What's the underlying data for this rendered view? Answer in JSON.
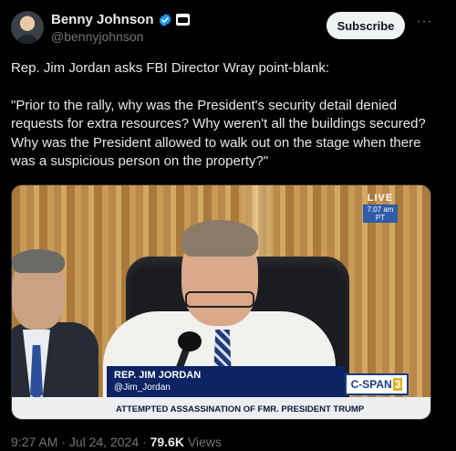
{
  "author": {
    "display_name": "Benny Johnson",
    "handle": "@bennyjohnson",
    "avatar_icon": "avatar-photo",
    "verified_icon": "verified-badge-icon",
    "affiliate_icon": "affiliate-badge-icon"
  },
  "actions": {
    "subscribe_label": "Subscribe",
    "more_icon": "more-options-icon",
    "more_glyph": "···"
  },
  "tweet": {
    "line1": "Rep. Jim Jordan asks FBI Director Wray point-blank:",
    "quote": "\"Prior to the rally, why was the President's security detail denied requests for extra resources? Why weren't all the buildings secured? Why was the President allowed to walk out on the stage when there was a suspicious person on the property?\""
  },
  "media": {
    "live_label": "LIVE",
    "live_time": "7:07 am PT",
    "lower_third_name": "REP. JIM JORDAN",
    "lower_third_handle": "@Jim_Jordan",
    "network_logo": "C-SPAN",
    "network_number": "3",
    "headline": "ATTEMPTED ASSASSINATION OF FMR. PRESIDENT TRUMP"
  },
  "meta": {
    "time": "9:27 AM",
    "separator": " · ",
    "date": "Jul 24, 2024",
    "views_count": "79.6K",
    "views_label": " Views"
  },
  "colors": {
    "background": "#000000",
    "text_primary": "#e7e9ea",
    "text_secondary": "#71767b",
    "verified_blue": "#1d9bf0",
    "subscribe_bg": "#eff3f4"
  }
}
